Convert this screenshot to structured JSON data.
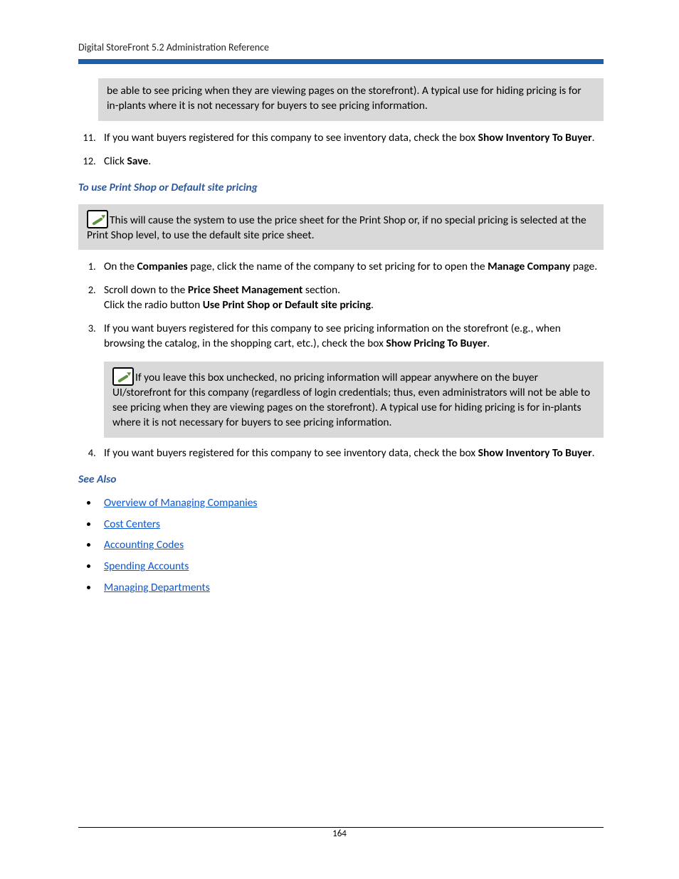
{
  "header": {
    "running_head": "Digital StoreFront 5.2 Administration Reference"
  },
  "note1": {
    "text": "be able to see pricing when they are viewing pages on the storefront). A typical use for hiding pricing is for in-plants where it is not necessary for buyers to see pricing information."
  },
  "step11": {
    "pre": "If you want buyers registered for this company to see inventory data, check the box ",
    "bold": "Show Inventory To Buyer",
    "post": "."
  },
  "step12": {
    "pre": "Click ",
    "bold": "Save",
    "post": "."
  },
  "subhead1": "To use Print Shop or Default site pricing",
  "note2": {
    "text": "This will cause the system to use the price sheet for the Print Shop or, if no special pricing is selected at the Print Shop level, to use the default site price sheet."
  },
  "s1": {
    "a": "On the ",
    "b": "Companies",
    "c": " page, click the name of the company to set pricing for to open the ",
    "d": "Manage Company",
    "e": " page."
  },
  "s2": {
    "a": "Scroll down to the ",
    "b": "Price Sheet Management",
    "c": " section.",
    "d": "Click the radio button ",
    "e": "Use Print Shop or Default site pricing",
    "f": "."
  },
  "s3": {
    "a": "If you want buyers registered for this company to see pricing information on the storefront (e.g., when browsing the catalog, in the shopping cart, etc.), check the box ",
    "b": "Show Pricing To Buyer",
    "c": "."
  },
  "note3": {
    "text": "If you leave this box unchecked, no pricing information will appear anywhere on the buyer UI/storefront for this company (regardless of login credentials; thus, even administrators will not be able to see pricing when they are viewing pages on the storefront). A typical use for hiding pricing is for in-plants where it is not necessary for buyers to see pricing information."
  },
  "s4": {
    "a": "If you want buyers registered for this company to see inventory data, check the box ",
    "b": "Show Inventory To Buyer",
    "c": "."
  },
  "see_also": {
    "heading": "See Also",
    "links": [
      "Overview of Managing Companies",
      "Cost Centers",
      "Accounting Codes",
      "Spending Accounts",
      "Managing Departments"
    ]
  },
  "page_number": "164"
}
